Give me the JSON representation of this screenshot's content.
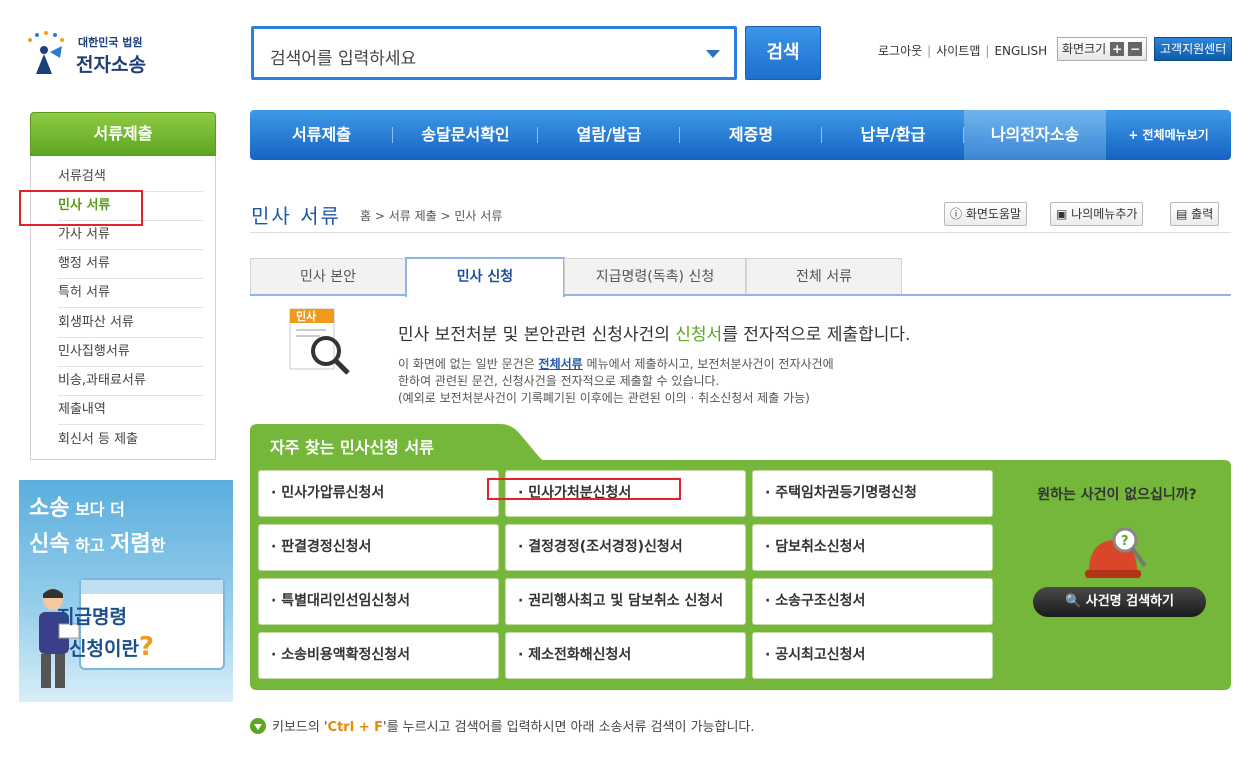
{
  "header": {
    "logo_top": "대한민국 법원",
    "logo_bottom": "전자소송",
    "search_placeholder": "검색어를 입력하세요",
    "search_button": "검색",
    "util": [
      "로그아웃",
      "사이트맵",
      "ENGLISH"
    ],
    "fontsize_label": "화면크기",
    "plus": "+",
    "minus": "−",
    "cs_center": "고객지원센터"
  },
  "sidebar": {
    "title": "서류제출",
    "items": [
      "서류검색",
      "민사 서류",
      "가사 서류",
      "행정 서류",
      "특허 서류",
      "회생파산 서류",
      "민사집행서류",
      "비송,과태료서류",
      "제출내역",
      "회신서 등 제출"
    ]
  },
  "banner": {
    "line1_a": "소송",
    "line1_b": "보다 더",
    "line2_a": "신속",
    "line2_b": "하고",
    "line2_c": "저렴",
    "line2_d": "한",
    "cal1": "지급명령",
    "cal2": "신청이란",
    "q": "?"
  },
  "nav": {
    "items": [
      "서류제출",
      "송달문서확인",
      "열람/발급",
      "제증명",
      "납부/환급",
      "나의전자소송"
    ],
    "all_menu": "+ 전체메뉴보기"
  },
  "page": {
    "title": "민사 서류",
    "breadcrumb": "홈 > 서류 제출 > 민사 서류",
    "help": "화면도움말",
    "mymenu": "나의메뉴추가",
    "print": "출력"
  },
  "tabs": [
    "민사 본안",
    "민사 신청",
    "지급명령(독촉) 신청",
    "전체 서류"
  ],
  "intro": {
    "icon_label": "민사",
    "title_a": "민사 보전처분 및 본안관련 신청사건의",
    "title_b": "신청서",
    "title_c": "를 전자적으로 제출합니다.",
    "desc1_a": "이 화면에 없는 일반 문건은",
    "desc1_link": "전체서류",
    "desc1_b": "메뉴에서 제출하시고, 보전처분사건이 전자사건에",
    "desc2": "한하여 관련된 문건, 신청사건을 전자적으로 제출할 수 있습니다.",
    "desc3": "(예외로 보전처분사건이 기록폐기된 이후에는 관련된 이의 · 취소신청서 제출 가능)"
  },
  "favorites": {
    "title": "자주 찾는 민사신청 서류",
    "items": [
      "· 민사가압류신청서",
      "· 민사가처분신청서",
      "· 주택임차권등기명령신청",
      "· 판결경정신청서",
      "· 결정경정(조서경정)신청서",
      "· 담보취소신청서",
      "· 특별대리인선임신청서",
      "· 권리행사최고 및 담보취소 신청서",
      "· 소송구조신청서",
      "· 소송비용액확정신청서",
      "· 제소전화해신청서",
      "· 공시최고신청서"
    ],
    "nocase_question": "원하는 사건이 없으십니까?",
    "nocase_button": "사건명 검색하기"
  },
  "tip": {
    "a": "키보드의 '",
    "key": "Ctrl + F",
    "b": "'를 누르시고 검색어를 입력하시면 아래 소송서류 검색이 가능합니다."
  }
}
